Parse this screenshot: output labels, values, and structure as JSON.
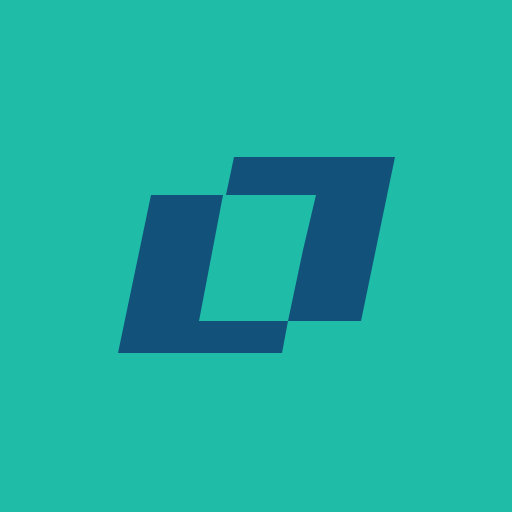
{
  "colors": {
    "background": "#1fbca8",
    "logo": "#11517a"
  },
  "logo": {
    "icon": "parallelogram-bracket-logo-icon"
  }
}
